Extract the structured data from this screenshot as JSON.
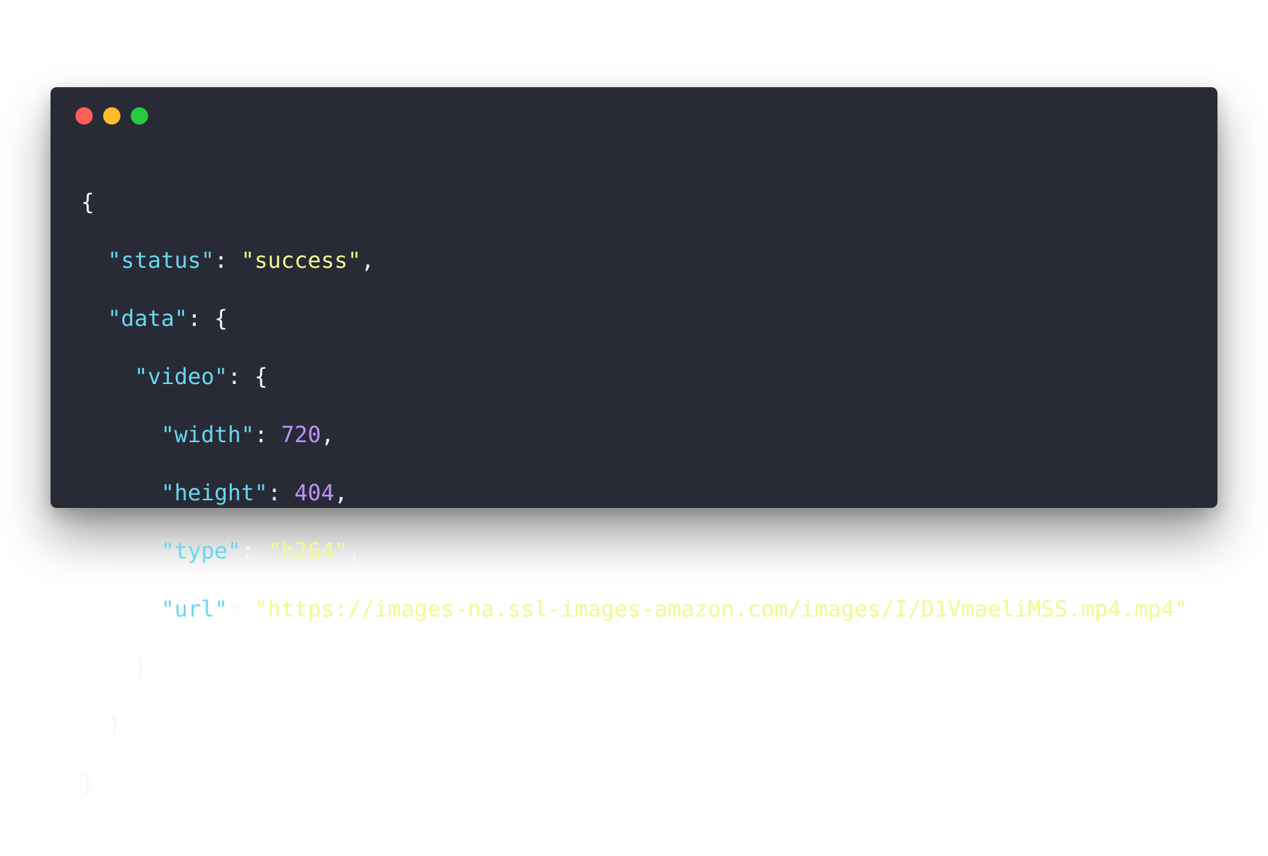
{
  "window": {
    "controls": [
      {
        "name": "close",
        "color": "#ff5f56"
      },
      {
        "name": "minimize",
        "color": "#ffbd2e"
      },
      {
        "name": "maximize",
        "color": "#27c93f"
      }
    ]
  },
  "code": {
    "open_brace": "{",
    "status_key": "\"status\"",
    "status_value": "\"success\"",
    "data_key": "\"data\"",
    "video_key": "\"video\"",
    "width_key": "\"width\"",
    "width_value": "720",
    "height_key": "\"height\"",
    "height_value": "404",
    "type_key": "\"type\"",
    "type_value": "\"h264\"",
    "url_key": "\"url\"",
    "url_value": "\"https://images-na.ssl-images-amazon.com/images/I/D1VmaeliMSS.mp4.mp4\"",
    "close_brace": "}"
  },
  "colors": {
    "background": "#282a36",
    "key": "#66d9ef",
    "string": "#f1fa8c",
    "number": "#bd93f9",
    "punctuation": "#f8f8f2"
  }
}
